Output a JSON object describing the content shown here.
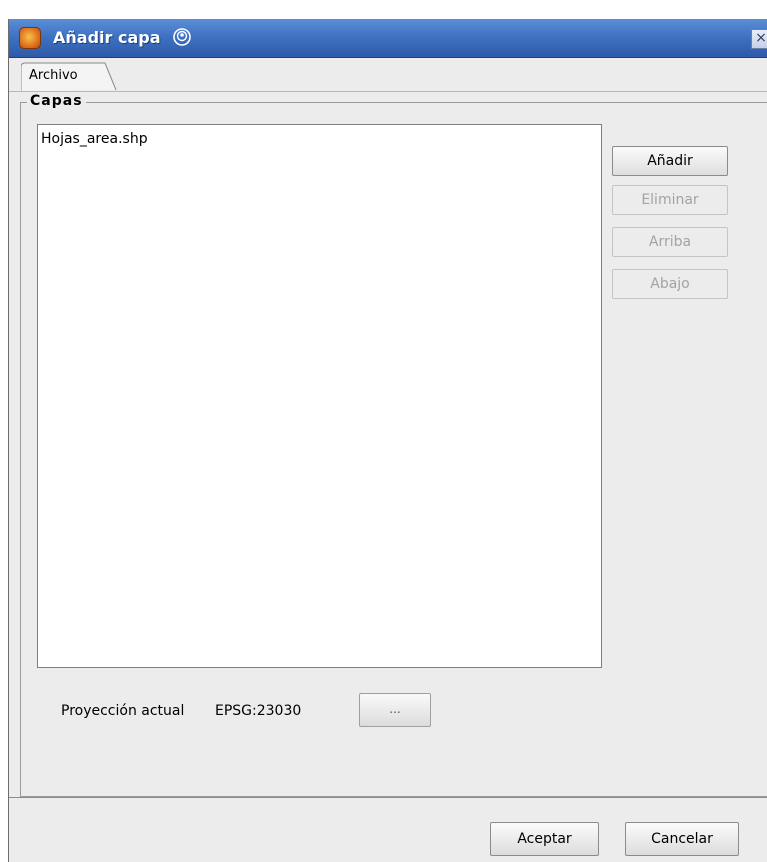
{
  "window": {
    "title": "Añadir capa",
    "close_glyph": "×"
  },
  "tabs": [
    {
      "label": "Archivo",
      "active": true
    }
  ],
  "layers_group": {
    "title": "Capas",
    "items": [
      "Hojas_area.shp"
    ]
  },
  "side_buttons": {
    "add": {
      "label": "Añadir",
      "enabled": true
    },
    "remove": {
      "label": "Eliminar",
      "enabled": false
    },
    "up": {
      "label": "Arriba",
      "enabled": false
    },
    "down": {
      "label": "Abajo",
      "enabled": false
    }
  },
  "projection": {
    "label": "Proyección actual",
    "value": "EPSG:23030",
    "button_label": "..."
  },
  "footer": {
    "ok_label": "Aceptar",
    "cancel_label": "Cancelar"
  },
  "colors": {
    "titlebar": "#3f72c4",
    "window_bg": "#ececec",
    "disabled_text": "#a3a3a3"
  },
  "icons": {
    "app": "gvsig-app-icon",
    "title_decoration": "swirl-icon",
    "close": "close-icon"
  }
}
